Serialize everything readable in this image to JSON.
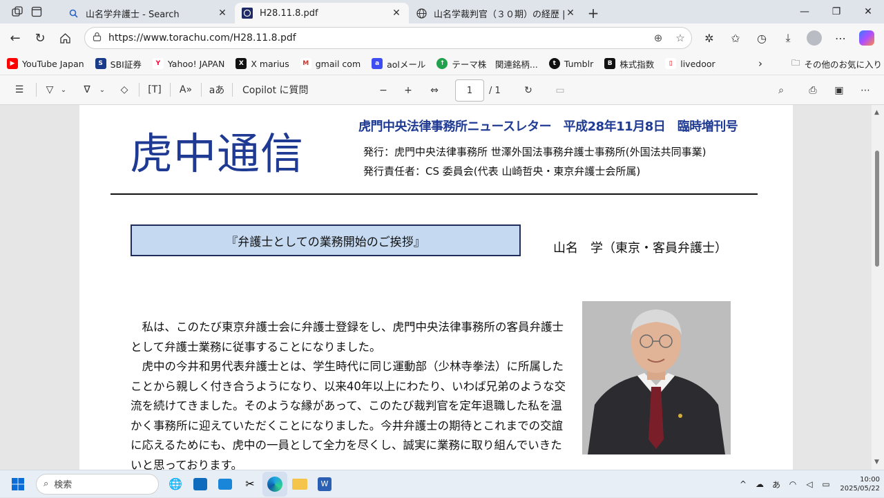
{
  "browser": {
    "tabs": [
      {
        "title": "山名学弁護士 - Search",
        "icon": "search-icon",
        "active": false
      },
      {
        "title": "H28.11.8.pdf",
        "icon": "pdf-icon",
        "active": true
      },
      {
        "title": "山名学裁判官（３０期）の経歴 | ",
        "icon": "globe-icon",
        "active": false
      }
    ],
    "url": "https://www.torachu.com/H28.11.8.pdf",
    "bookmarks": [
      {
        "label": "YouTube Japan",
        "color": "#ff0000"
      },
      {
        "label": "SBI証券",
        "color": "#1a3a8a"
      },
      {
        "label": "Yahoo! JAPAN",
        "color": "#ff0033"
      },
      {
        "label": "X marius",
        "color": "#111111"
      },
      {
        "label": "gmail com",
        "color": "#d93025"
      },
      {
        "label": "aolメール",
        "color": "#3e4df1"
      },
      {
        "label": "テーマ株　関連銘柄...",
        "color": "#21a14b"
      },
      {
        "label": "Tumblr",
        "color": "#111111"
      },
      {
        "label": "株式指数",
        "color": "#111111"
      },
      {
        "label": "livedoor",
        "color": "#e60012"
      }
    ],
    "other_bookmarks": "その他のお気に入り"
  },
  "pdf_toolbar": {
    "copilot": "Copilot に質問",
    "page_current": "1",
    "page_total": "/ 1"
  },
  "document": {
    "masthead": "虎中通信",
    "newsletter_line": "虎門中央法律事務所ニュースレター　平成28年11月8日　臨時増刊号",
    "publisher": "発行：虎門中央法律事務所 世澤外国法事務弁護士事務所(外国法共同事業)",
    "responsible": "発行責任者：CS 委員会(代表 山崎哲央・東京弁護士会所属)",
    "article_title": "『弁護士としての業務開始のご挨拶』",
    "author": "山名　学（東京・客員弁護士）",
    "paragraphs": [
      "　私は、このたび東京弁護士会に弁護士登録をし、虎門中央法律事務所の客員弁護士として弁護士業務に従事することになりました。",
      "　虎中の今井和男代表弁護士とは、学生時代に同じ運動部（少林寺拳法）に所属したことから親しく付き合うようになり、以来40年以上にわたり、いわば兄弟のような交流を続けてきました。そのような縁があって、このたび裁判官を定年退職した私を温かく事務所に迎えていただくことになりました。今井弁護士の期待とこれまでの交誼に応えるためにも、虎中の一員として全力を尽くし、誠実に業務に取り組んでいきたいと思っております。"
    ]
  },
  "taskbar": {
    "search_placeholder": "検索",
    "ime": "あ",
    "time": "10:00",
    "date": "2025/05/22"
  }
}
